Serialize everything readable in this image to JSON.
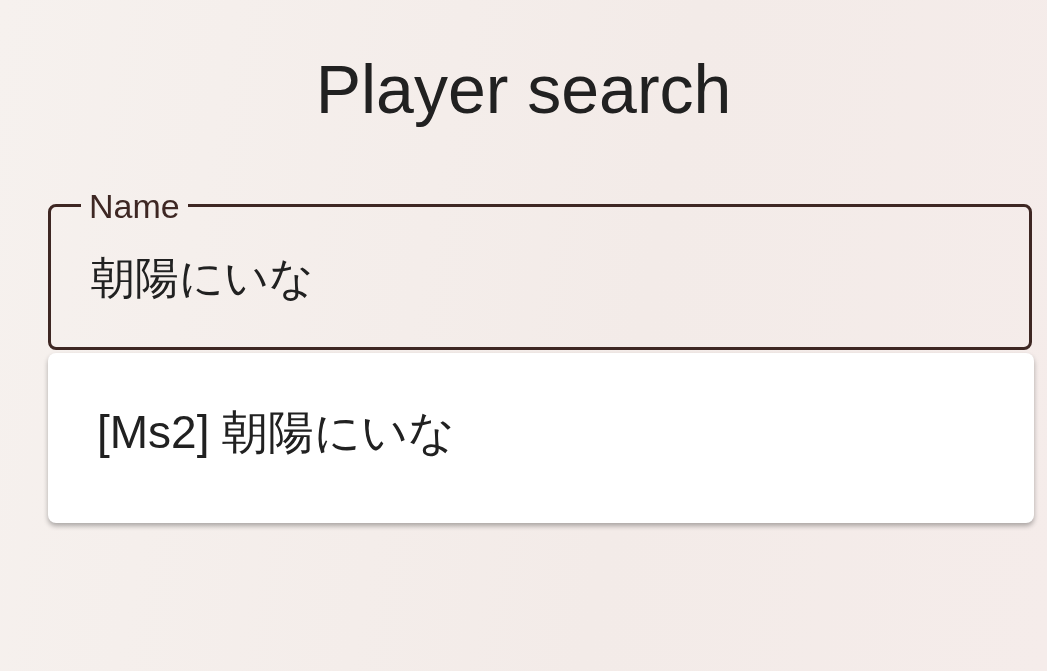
{
  "title": "Player search",
  "name_field": {
    "label": "Name",
    "value": "朝陽にいな"
  },
  "suggestions": [
    {
      "label": "[Ms2] 朝陽にいな"
    }
  ]
}
